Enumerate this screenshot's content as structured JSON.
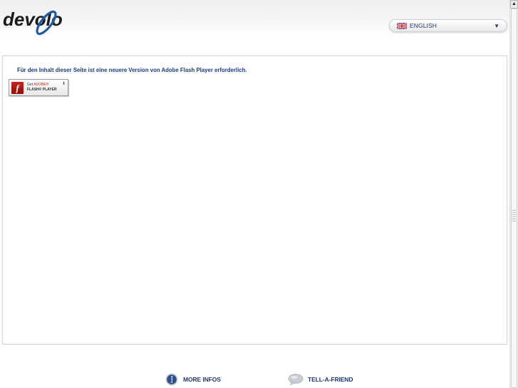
{
  "header": {
    "logo_text": "devolo",
    "language": {
      "flag_icon": "uk-flag-icon",
      "label": "ENGLISH",
      "chevron": "▼"
    }
  },
  "content": {
    "notice": "Für den Inhalt dieser Seite ist eine neuere Version von Adobe Flash Player erforderlich.",
    "flash_badge": {
      "line1_prefix": "Get",
      "line1_brand": "ADOBE®",
      "line2": "FLASH® PLAYER",
      "icon": "adobe-flash-icon"
    }
  },
  "footer": {
    "links": [
      {
        "label": "MORE INFOS",
        "icon": "info-icon"
      },
      {
        "label": "TELL-A-FRIEND",
        "icon": "speech-bubble-icon"
      }
    ]
  },
  "colors": {
    "brand_navy": "#1f3a6e",
    "notice_blue": "#1c3a86",
    "flash_red": "#c8221c",
    "logo_blue": "#1a5aa8"
  }
}
